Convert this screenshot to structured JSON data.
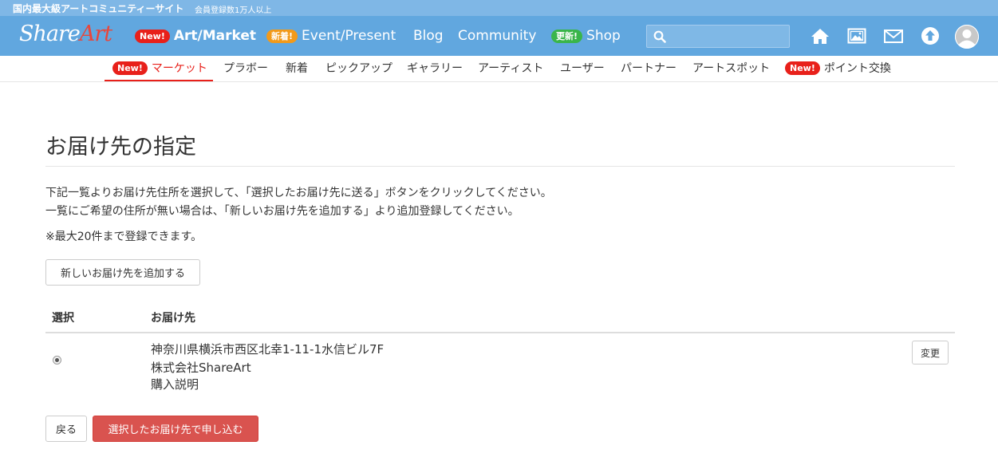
{
  "topbar": {
    "tagline": "国内最大級アートコミュニティーサイト",
    "members": "会員登録数1万人以上"
  },
  "header": {
    "logo_part1": "Share",
    "logo_part2": "Art",
    "nav": [
      {
        "badge": "New!",
        "label": "Art/Market"
      },
      {
        "badge": "新着!",
        "label": "Event/Present"
      },
      {
        "badge": "",
        "label": "Blog"
      },
      {
        "badge": "",
        "label": "Community"
      },
      {
        "badge": "更新!",
        "label": "Shop"
      }
    ],
    "search_placeholder": ""
  },
  "subnav": [
    {
      "badge": "New!",
      "label": "マーケット"
    },
    {
      "badge": "",
      "label": "プラボー"
    },
    {
      "badge": "",
      "label": "新着"
    },
    {
      "badge": "",
      "label": "ピックアップ"
    },
    {
      "badge": "",
      "label": "ギャラリー"
    },
    {
      "badge": "",
      "label": "アーティスト"
    },
    {
      "badge": "",
      "label": "ユーザー"
    },
    {
      "badge": "",
      "label": "パートナー"
    },
    {
      "badge": "",
      "label": "アートスポット"
    },
    {
      "badge": "New!",
      "label": "ポイント交換"
    }
  ],
  "page": {
    "title": "お届け先の指定",
    "desc1": "下記一覧よりお届け先住所を選択して、「選択したお届け先に送る」ボタンをクリックしてください。",
    "desc2": "一覧にご希望の住所が無い場合は、「新しいお届け先を追加する」より追加登録してください。",
    "note": "※最大20件まで登録できます。",
    "add_button": "新しいお届け先を追加する",
    "table": {
      "col_select": "選択",
      "col_address": "お届け先",
      "rows": [
        {
          "line1": "神奈川県横浜市西区北幸1-11-1水信ビル7F",
          "line2": "株式会社ShareArt",
          "line3": "購入説明",
          "edit_button": "変更"
        }
      ]
    },
    "back_button": "戻る",
    "submit_button": "選択したお届け先で申し込む"
  },
  "colors": {
    "header_bg": "#61a7df",
    "topbar_bg": "#7fb7e6",
    "accent_red": "#e8201a",
    "danger_btn": "#d9534f"
  }
}
